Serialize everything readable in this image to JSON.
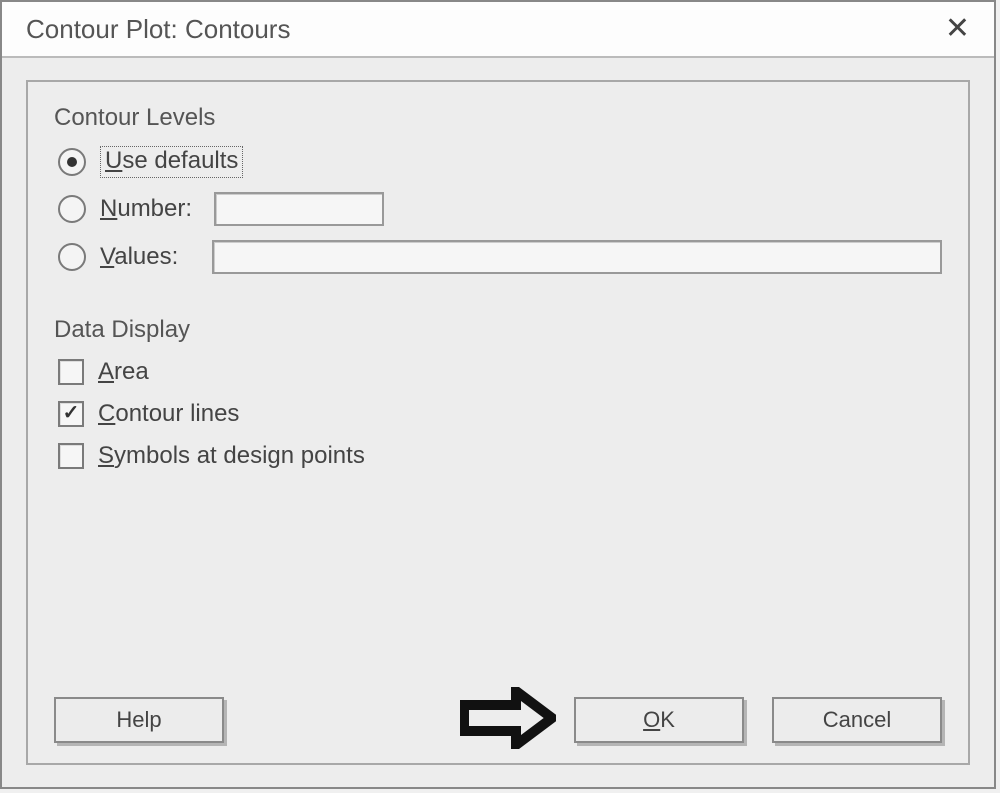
{
  "title": "Contour Plot: Contours",
  "groups": {
    "contour_levels": {
      "label": "Contour Levels",
      "use_defaults": {
        "label": "Use defaults",
        "ul": "U",
        "rest": "se defaults",
        "selected": true
      },
      "number": {
        "label": "Number:",
        "ul": "N",
        "rest": "umber:",
        "value": ""
      },
      "values": {
        "label": "Values:",
        "ul": "V",
        "rest": "alues:",
        "value": ""
      }
    },
    "data_display": {
      "label": "Data Display",
      "area": {
        "label": "Area",
        "ul": "A",
        "rest": "rea",
        "checked": false
      },
      "contour": {
        "label": "Contour lines",
        "ul": "C",
        "rest": "ontour lines",
        "checked": true
      },
      "symbols": {
        "label": "Symbols at design points",
        "ul": "S",
        "rest": "ymbols at design points",
        "checked": false
      }
    }
  },
  "buttons": {
    "help": "Help",
    "ok_ul": "O",
    "ok_rest": "K",
    "cancel": "Cancel"
  }
}
